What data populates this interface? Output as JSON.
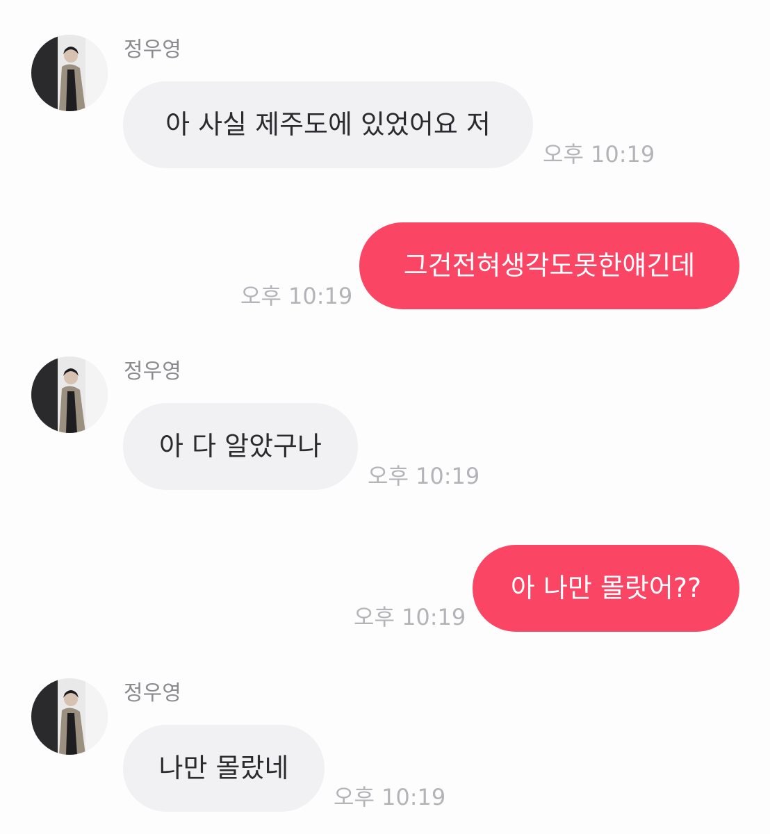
{
  "chat": {
    "messages": [
      {
        "direction": "incoming",
        "sender": "정우영",
        "text": "아 사실 제주도에 있었어요 저",
        "time": "오후 10:19"
      },
      {
        "direction": "outgoing",
        "text": "그건전혀생각도못한얘긴데",
        "time": "오후 10:19"
      },
      {
        "direction": "incoming",
        "sender": "정우영",
        "text": "아 다 알았구나",
        "time": "오후 10:19"
      },
      {
        "direction": "outgoing",
        "text": "아 나만 몰랏어??",
        "time": "오후 10:19"
      },
      {
        "direction": "incoming",
        "sender": "정우영",
        "text": "나만 몰랐네",
        "time": "오후 10:19"
      }
    ]
  },
  "colors": {
    "background": "#fdfdfe",
    "incoming_bubble": "#f1f1f4",
    "outgoing_bubble": "#fa4565",
    "timestamp": "#b3b3b8",
    "sender_name": "#8a8a8f"
  }
}
